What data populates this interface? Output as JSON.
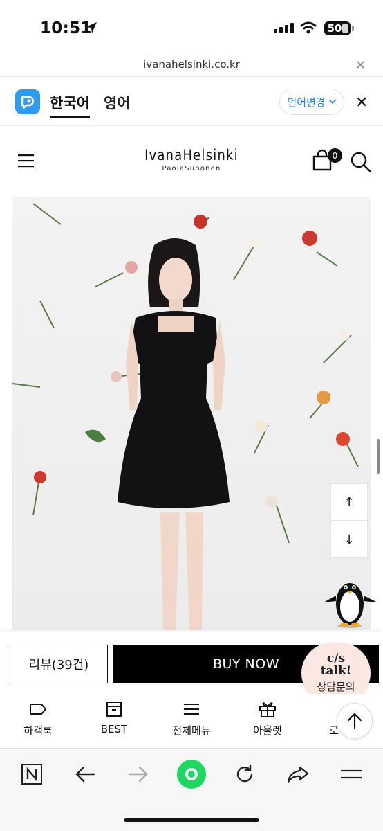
{
  "status_bar": {
    "time": "10:51",
    "battery": "50"
  },
  "browser": {
    "url": "ivanahelsinki.co.kr",
    "close_icon": "close-icon"
  },
  "translate_bar": {
    "tab_korean": "한국어",
    "tab_english": "영어",
    "change_language": "언어변경",
    "logo_icon": "papago-icon"
  },
  "site_header": {
    "brand": "IvanaHelsinki",
    "brand_sub": "PaolaSuhonen",
    "cart_count": "0"
  },
  "product": {
    "image_alt_icon": "product-photo",
    "scroll_up": "↑",
    "scroll_down": "↓"
  },
  "actions": {
    "review_label": "리뷰(39건)",
    "buy_now_label": "BUY NOW",
    "cs_title_line1": "c/s",
    "cs_title_line2": "talk!",
    "cs_sub": "상담문의"
  },
  "bottom_nav": {
    "items": [
      {
        "label": "하객룩",
        "icon": "tag-icon"
      },
      {
        "label": "BEST",
        "icon": "box-icon"
      },
      {
        "label": "전체메뉴",
        "icon": "menu-icon"
      },
      {
        "label": "아울렛",
        "icon": "gift-icon"
      },
      {
        "label": "로",
        "icon": ""
      }
    ]
  },
  "colors": {
    "accent": "#2b7de1",
    "buy_now_bg": "#000000",
    "cs_bg": "#fbe8e3",
    "green_button": "#1ed760"
  }
}
